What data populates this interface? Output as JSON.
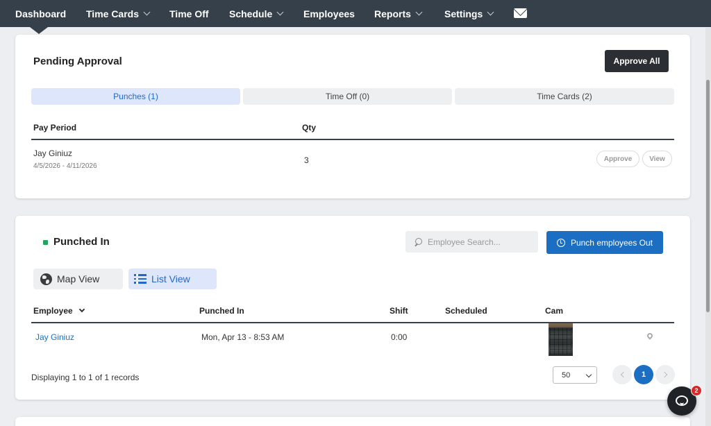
{
  "nav": {
    "dashboard": "Dashboard",
    "time_cards": "Time Cards",
    "time_off": "Time Off",
    "schedule": "Schedule",
    "employees": "Employees",
    "reports": "Reports",
    "settings": "Settings"
  },
  "pending": {
    "title": "Pending Approval",
    "approve_all": "Approve All",
    "tabs": [
      {
        "label": "Punches (1)",
        "active": true
      },
      {
        "label": "Time Off (0)",
        "active": false
      },
      {
        "label": "Time Cards (2)",
        "active": false
      }
    ],
    "headers": {
      "pay_period": "Pay Period",
      "qty": "Qty"
    },
    "rows": [
      {
        "name": "Jay Giniuz",
        "period": "4/5/2026 - 4/11/2026",
        "qty": "3",
        "approve": "Approve",
        "view": "View"
      }
    ]
  },
  "punched": {
    "title": "Punched In",
    "status_color": "#24a55d",
    "search_placeholder": "Employee Search...",
    "punch_out_label": "Punch employees Out",
    "map_view": "Map View",
    "list_view": "List View",
    "headers": {
      "employee": "Employee",
      "punched_in": "Punched In",
      "shift": "Shift",
      "scheduled": "Scheduled",
      "cam": "Cam"
    },
    "rows": [
      {
        "employee": "Jay Giniuz",
        "punched_in": "Mon, Apr 13 - 8:53 AM",
        "shift": "0:00",
        "scheduled": ""
      }
    ],
    "footer": "Displaying 1 to 1 of 1 records",
    "page_size": "50",
    "current_page": "1"
  },
  "chat": {
    "badge": "2"
  },
  "colors": {
    "nav_bg": "#36404a",
    "accent": "#1b6ec2"
  }
}
